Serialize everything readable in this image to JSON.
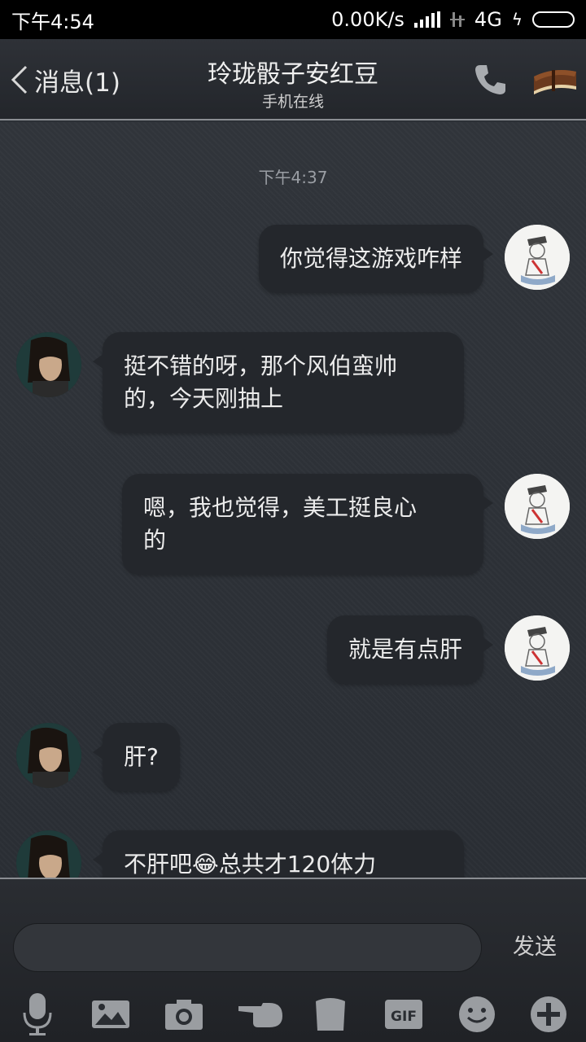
{
  "status_bar": {
    "time": "下午4:54",
    "speed": "0.00K/s",
    "network": "4G",
    "bolt": "ϟ"
  },
  "header": {
    "back_label": "消息(1)",
    "title": "玲珑骰子安红豆",
    "subtitle": "手机在线",
    "icons": [
      "phone-icon",
      "book-icon"
    ]
  },
  "chat": {
    "timestamp": "下午4:37",
    "messages": [
      {
        "side": "me",
        "lines": [
          "你觉得这游戏咋样"
        ]
      },
      {
        "side": "them",
        "lines": [
          "挺不错的呀，那个风伯蛮帅",
          "的，今天刚抽上"
        ]
      },
      {
        "side": "me",
        "lines": [
          "嗯，我也觉得，美工挺良心",
          "的"
        ]
      },
      {
        "side": "me",
        "lines": [
          "就是有点肝"
        ]
      },
      {
        "side": "them",
        "lines": [
          "肝?"
        ]
      },
      {
        "side": "them",
        "lines": [
          "不肝吧😂总共才120体力"
        ]
      }
    ]
  },
  "input": {
    "value": "",
    "placeholder": "",
    "send_label": "发送"
  },
  "toolbar": {
    "items": [
      "microphone-icon",
      "image-icon",
      "camera-icon",
      "poke-hand-icon",
      "cup-icon",
      "gif-icon",
      "emoji-icon",
      "plus-icon"
    ],
    "gif_text": "GIF"
  },
  "colors": {
    "background": "#2c3036",
    "bubble": "#24272c",
    "status_bar": "#000000"
  }
}
